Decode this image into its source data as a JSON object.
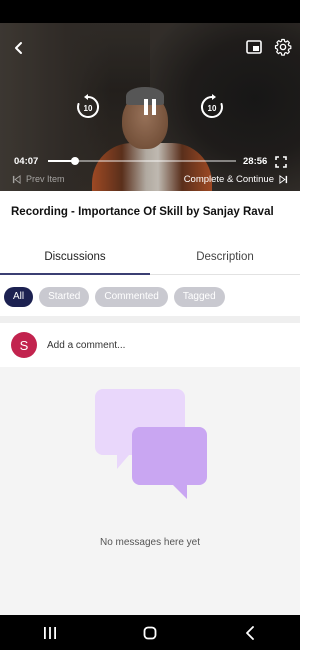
{
  "player": {
    "current_time": "04:07",
    "duration": "28:56",
    "progress": 0.142,
    "skip_back_seconds": "10",
    "skip_forward_seconds": "10",
    "prev_item_label": "Prev Item",
    "complete_label": "Complete & Continue"
  },
  "content": {
    "title": "Recording - Importance Of Skill by Sanjay Raval"
  },
  "tabs": [
    {
      "label": "Discussions",
      "active": true
    },
    {
      "label": "Description",
      "active": false
    }
  ],
  "filters": [
    {
      "label": "All",
      "active": true
    },
    {
      "label": "Started",
      "active": false
    },
    {
      "label": "Commented",
      "active": false
    },
    {
      "label": "Tagged",
      "active": false
    }
  ],
  "comment": {
    "avatar_letter": "S",
    "placeholder": "Add a comment..."
  },
  "empty_state": {
    "message": "No messages here yet"
  },
  "colors": {
    "accent": "#1c2151",
    "avatar": "#c2234e",
    "chip_inactive": "#c9c9d0",
    "bubble_light": "#e9d7fb",
    "bubble_dark": "#c9a6f2"
  },
  "icons": [
    "back-icon",
    "pip-icon",
    "gear-icon",
    "rewind-10-icon",
    "pause-icon",
    "forward-10-icon",
    "fullscreen-icon",
    "skip-previous-icon",
    "skip-next-icon",
    "chat-bubbles-icon",
    "recents-icon",
    "home-icon",
    "back-nav-icon"
  ]
}
